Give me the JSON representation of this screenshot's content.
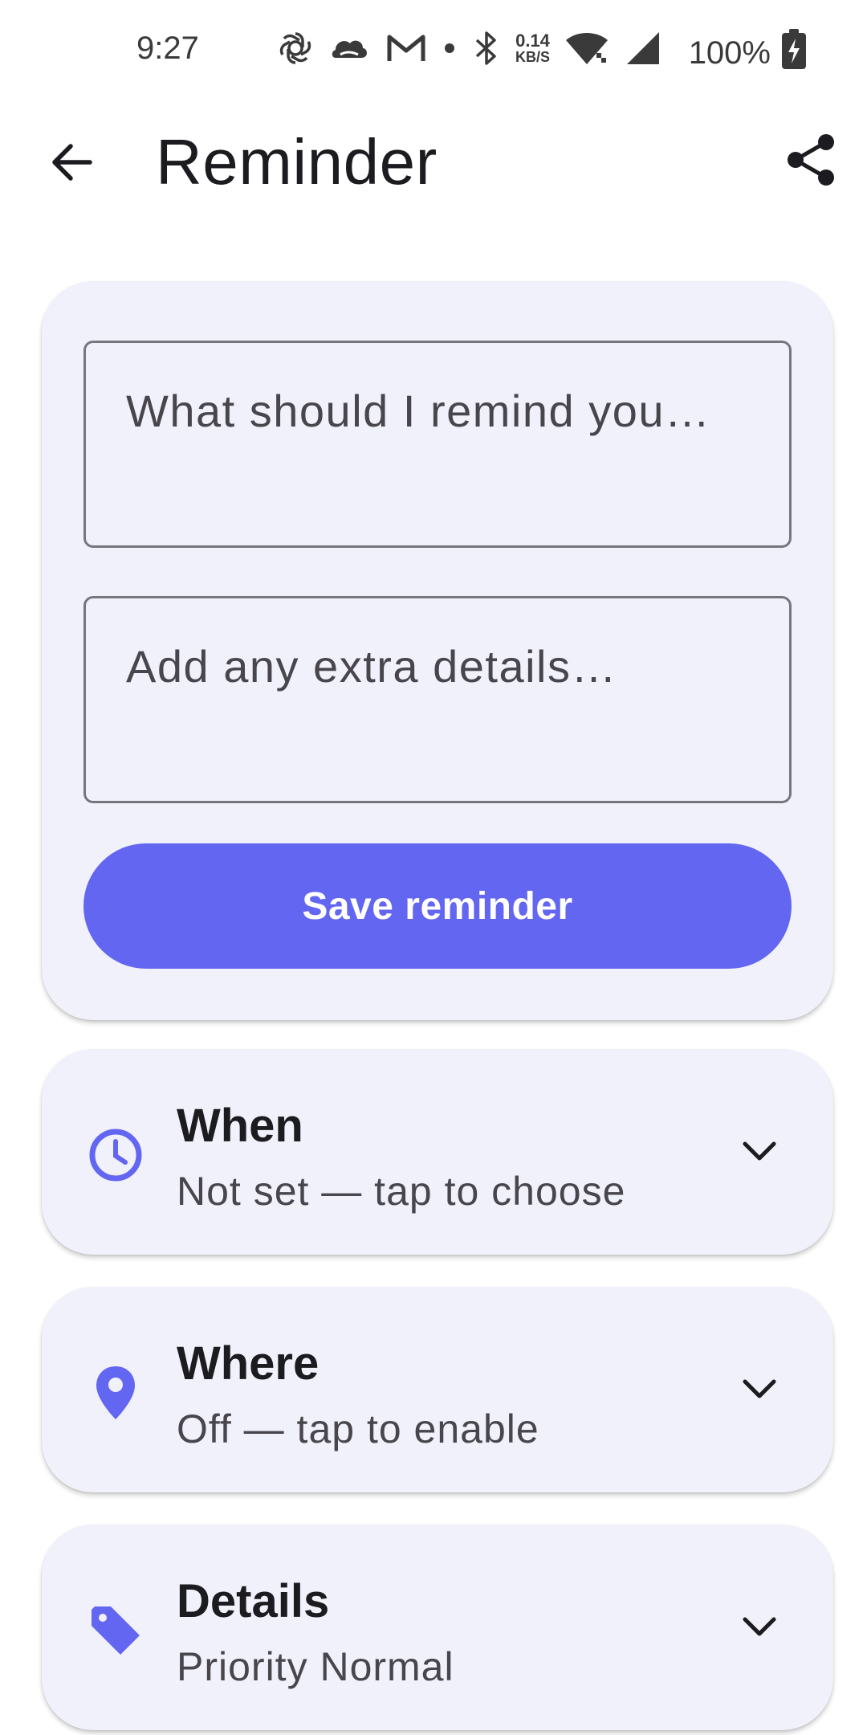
{
  "status_bar": {
    "time": "9:27",
    "net_speed_value": "0.14",
    "net_speed_unit": "KB/S",
    "battery": "100%",
    "icons": [
      "openai-icon",
      "cloud-icon",
      "gmail-icon",
      "dot-icon",
      "bluetooth-icon",
      "wifi-icon",
      "signal-icon",
      "battery-charging-icon"
    ]
  },
  "app_bar": {
    "title": "Reminder",
    "back_icon": "arrow-back-icon",
    "share_icon": "share-icon"
  },
  "compose": {
    "title_placeholder": "What should I remind you…",
    "details_placeholder": "Add any extra details…",
    "save_label": "Save reminder"
  },
  "options": {
    "when": {
      "title": "When",
      "subtitle": "Not set — tap to choose",
      "icon": "clock-icon"
    },
    "where": {
      "title": "Where",
      "subtitle": "Off — tap to enable",
      "icon": "location-pin-icon"
    },
    "details": {
      "title": "Details",
      "subtitle": "Priority Normal",
      "icon": "tag-icon"
    }
  },
  "colors": {
    "accent": "#6366f1",
    "card_background": "#f1f1fb",
    "text_primary": "#1c1b1f",
    "text_secondary": "#48464c"
  }
}
